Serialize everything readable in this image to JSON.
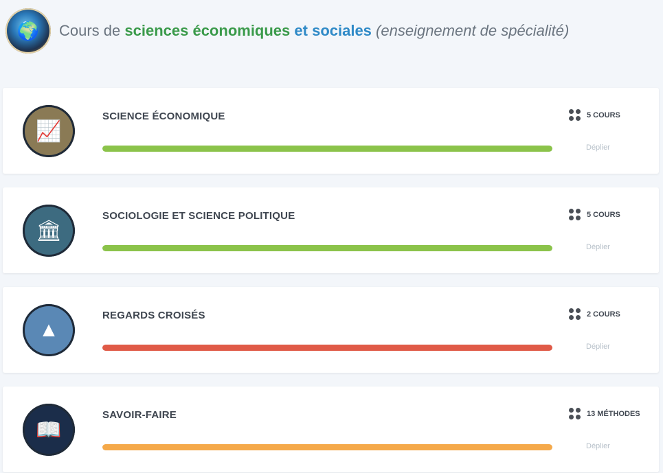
{
  "header": {
    "title_prefix": "Cours de ",
    "title_green": "sciences économiques",
    "title_mid": " et ",
    "title_blue": "sociales",
    "title_suffix": " (enseignement de spécialité)",
    "logo_icon": "globe-book-icon"
  },
  "cards": [
    {
      "title": "SCIENCE ÉCONOMIQUE",
      "count_label": "5 COURS",
      "expand_label": "Déplier",
      "progress": 1.0,
      "bar_color": "#8bc34a",
      "image_icon": "finance-icon",
      "image_bg": "#8a7a55"
    },
    {
      "title": "SOCIOLOGIE ET SCIENCE POLITIQUE",
      "count_label": "5 COURS",
      "expand_label": "Déplier",
      "progress": 1.0,
      "bar_color": "#8bc34a",
      "image_icon": "france-map-icon",
      "image_bg": "#3d6b80"
    },
    {
      "title": "REGARDS CROISÉS",
      "count_label": "2 COURS",
      "expand_label": "Déplier",
      "progress": 1.0,
      "bar_color": "#e05a47",
      "image_icon": "pyramid-icon",
      "image_bg": "#5a88b5"
    },
    {
      "title": "SAVOIR-FAIRE",
      "count_label": "13 MÉTHODES",
      "expand_label": "Déplier",
      "progress": 1.0,
      "bar_color": "#f5a94a",
      "image_icon": "open-book-icon",
      "image_bg": "#1b2d4a"
    }
  ]
}
